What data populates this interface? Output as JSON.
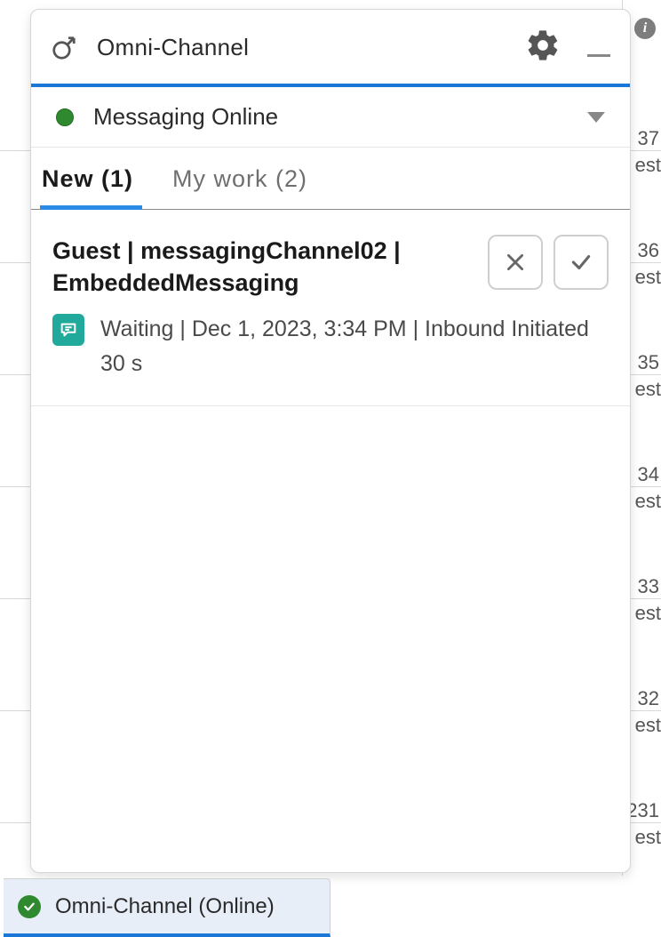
{
  "header": {
    "title": "Omni-Channel"
  },
  "status": {
    "label": "Messaging Online",
    "color": "#2f8a2f"
  },
  "tabs": {
    "new": {
      "label": "New (1)",
      "active": true
    },
    "mywork": {
      "label": "My work (2)",
      "active": false
    }
  },
  "item": {
    "title": "Guest | messagingChannel02 | EmbeddedMessaging",
    "state": "Waiting",
    "timestamp": "Dec 1, 2023, 3:34 PM",
    "direction": "Inbound Initiated",
    "elapsed": "30 s"
  },
  "footer": {
    "label": "Omni-Channel (Online)"
  },
  "bg": {
    "rows": [
      "37",
      "36",
      "35",
      "34",
      "33",
      "32",
      "231"
    ],
    "sub": "est"
  }
}
